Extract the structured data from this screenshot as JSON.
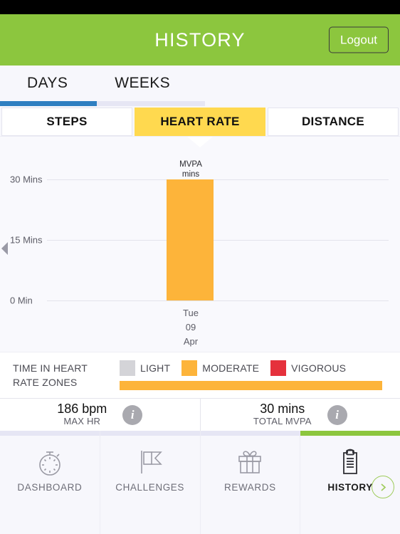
{
  "header": {
    "title": "HISTORY",
    "logout_label": "Logout",
    "brand_color": "#8cc63e"
  },
  "period_tabs": [
    {
      "label": "DAYS",
      "active": true,
      "indicator_color": "#2f7fc1"
    },
    {
      "label": "WEEKS",
      "active": false,
      "indicator_color": "#e6e6f4"
    }
  ],
  "metric_tabs": [
    {
      "label": "STEPS",
      "active": false
    },
    {
      "label": "HEART RATE",
      "active": true
    },
    {
      "label": "DISTANCE",
      "active": false
    }
  ],
  "metric_active_color": "#ffd94f",
  "chart_data": {
    "type": "bar",
    "title": "",
    "categories": [
      "Tue 09 Apr"
    ],
    "x_tick_lines": [
      "Tue",
      "09",
      "Apr"
    ],
    "values": [
      30
    ],
    "series": [
      {
        "name": "MVPA mins",
        "values": [
          30
        ],
        "color": "#fdb43a"
      }
    ],
    "bar_label": "MVPA\nmins",
    "ylabel": "",
    "xlabel": "",
    "ylim": [
      0,
      30
    ],
    "yticks": [
      0,
      15,
      30
    ],
    "ytick_labels": [
      "0 Min",
      "15 Mins",
      "30 Mins"
    ],
    "grid": true,
    "legend": false,
    "nav_prev_available": true
  },
  "zones": {
    "title": "TIME IN HEART\nRATE ZONES",
    "legend": [
      {
        "label": "LIGHT",
        "color": "#d4d4d8"
      },
      {
        "label": "MODERATE",
        "color": "#fdb43a"
      },
      {
        "label": "VIGOROUS",
        "color": "#e5313c"
      }
    ],
    "distribution": [
      {
        "label": "LIGHT",
        "color": "#d4d4d8",
        "percent": 0
      },
      {
        "label": "MODERATE",
        "color": "#fdb43a",
        "percent": 96
      },
      {
        "label": "VIGOROUS",
        "color": "#e5313c",
        "percent": 0
      }
    ]
  },
  "stats": [
    {
      "value": "186 bpm",
      "label": "MAX HR",
      "info": "i"
    },
    {
      "value": "30 mins",
      "label": "TOTAL MVPA",
      "info": "i"
    }
  ],
  "bottom_nav": {
    "items": [
      {
        "label": "DASHBOARD",
        "icon": "stopwatch-icon",
        "active": false
      },
      {
        "label": "CHALLENGES",
        "icon": "flag-icon",
        "active": false
      },
      {
        "label": "REWARDS",
        "icon": "gift-icon",
        "active": false
      },
      {
        "label": "HISTORY",
        "icon": "clipboard-icon",
        "active": true
      }
    ],
    "next_button": "chevron-right-icon"
  }
}
